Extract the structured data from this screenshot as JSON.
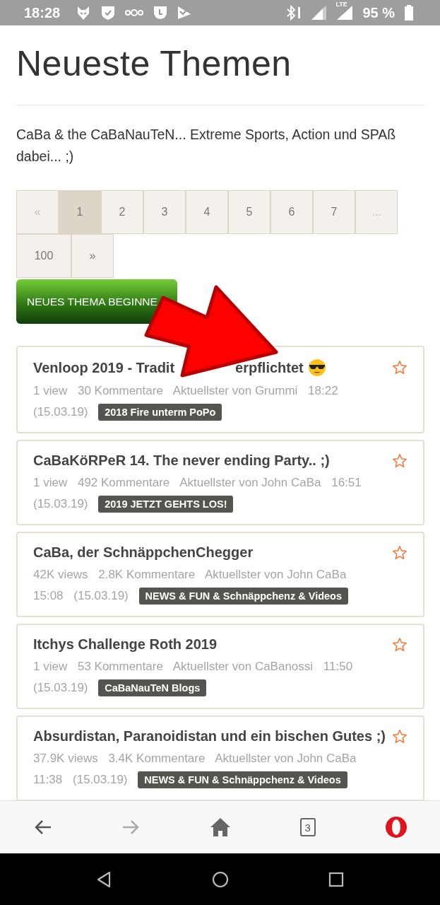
{
  "status_bar": {
    "time": "18:28",
    "network": "LTE",
    "battery": "95 %"
  },
  "page": {
    "title": "Neueste Themen",
    "description": "CaBa & the CaBaNauTeN... Extreme Sports, Action und SPAß dabei... ;)"
  },
  "pagination": [
    {
      "label": "«",
      "selected": false,
      "disabled": true
    },
    {
      "label": "1",
      "selected": true,
      "disabled": false
    },
    {
      "label": "2",
      "selected": false,
      "disabled": false
    },
    {
      "label": "3",
      "selected": false,
      "disabled": false
    },
    {
      "label": "4",
      "selected": false,
      "disabled": false
    },
    {
      "label": "5",
      "selected": false,
      "disabled": false
    },
    {
      "label": "6",
      "selected": false,
      "disabled": false
    },
    {
      "label": "7",
      "selected": false,
      "disabled": false
    },
    {
      "label": "...",
      "selected": false,
      "disabled": true
    },
    {
      "label": "100",
      "selected": false,
      "disabled": false
    },
    {
      "label": "»",
      "selected": false,
      "disabled": false
    }
  ],
  "new_topic_button": "NEUES THEMA BEGINNE",
  "topics": [
    {
      "title": "Venloop 2019 - Tradit",
      "title_end": "erpflichtet",
      "meta": [
        "1 view",
        "30 Kommentare",
        "Aktuellster von Grummi",
        "18:22",
        "(15.03.19)"
      ],
      "tag": "2018 Fire unterm PoPo"
    },
    {
      "title": "CaBaKöRPeR 14. The never ending Party.. ;)",
      "meta": [
        "1 view",
        "492 Kommentare",
        "Aktuellster von John CaBa",
        "16:51",
        "(15.03.19)"
      ],
      "tag": "2019 JETZT GEHTS LOS!"
    },
    {
      "title": "CaBa, der SchnäppchenChegger",
      "meta": [
        "42K views",
        "2.8K Kommentare",
        "Aktuellster von John CaBa",
        "15:08",
        "(15.03.19)"
      ],
      "tag": "NEWS & FUN & Schnäppchenz & Videos"
    },
    {
      "title": "Itchys Challenge Roth 2019",
      "meta": [
        "1 view",
        "53 Kommentare",
        "Aktuellster von CaBanossi",
        "11:50",
        "(15.03.19)"
      ],
      "tag": "CaBaNauTeN Blogs"
    },
    {
      "title": "Absurdistan, Paranoidistan und ein bischen Gutes ;)",
      "meta": [
        "37.9K views",
        "3.4K Kommentare",
        "Aktuellster von John CaBa",
        "11:38",
        "(15.03.19)"
      ],
      "tag": "NEWS & FUN & Schnäppchenz & Videos"
    }
  ],
  "browser_toolbar": {
    "forward_disabled": true,
    "tab_count": "3"
  }
}
